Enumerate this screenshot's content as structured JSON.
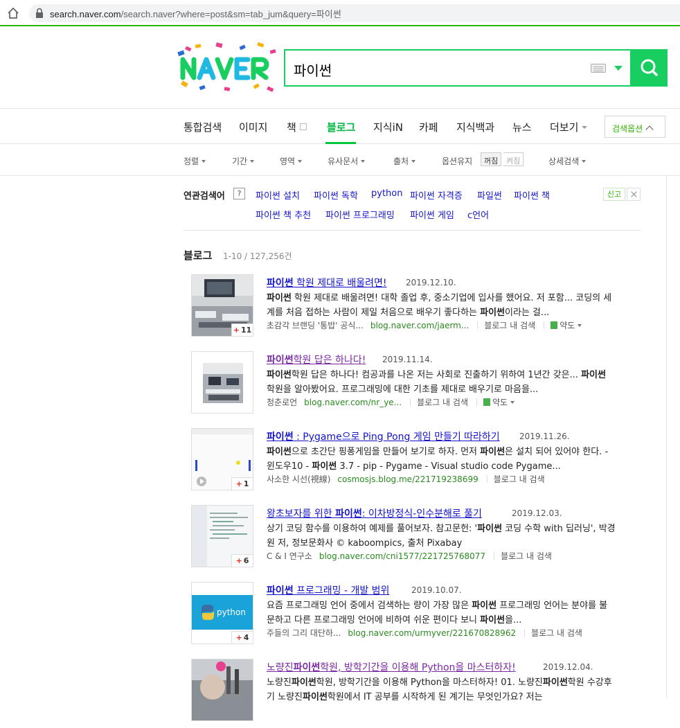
{
  "browser": {
    "url_host": "search.naver.com",
    "url_rest": "/search.naver?where=post&sm=tab_jum&query=파이썬"
  },
  "search": {
    "query": "파이썬"
  },
  "nav": {
    "tabs": [
      "통합검색",
      "이미지",
      "책",
      "블로그",
      "지식iN",
      "카페",
      "지식백과",
      "뉴스",
      "더보기"
    ],
    "active": "블로그",
    "options_button": "검색옵션"
  },
  "filters": {
    "items": [
      "정렬",
      "기간",
      "영역",
      "유사문서",
      "출처",
      "옵션유지",
      "상세검색"
    ],
    "toggle_on": "꺼짐",
    "toggle_off": "켜짐"
  },
  "related": {
    "label": "연관검색어",
    "help": "?",
    "row1": [
      "파이썬 설치",
      "파이썬 독학",
      "python",
      "파이썬 자격증",
      "파일썬",
      "파이썬 책"
    ],
    "row2": [
      "파이썬 책 추천",
      "파이썬 프로그래밍",
      "파이썬 게임",
      "c언어"
    ],
    "report": "신고"
  },
  "section": {
    "title": "블로그",
    "count": "1-10 / 127,256건"
  },
  "results": [
    {
      "title_bold": "파이썬",
      "title_rest": " 학원 제대로 배울려면!",
      "date": "2019.12.10.",
      "desc_l1_bold": "파이썬",
      "desc_l1": " 학원 제대로 배울려면! 대학 졸업 후, 중소기업에 입사를 했어요. 저 포함... 코딩의 세",
      "desc_l2": "계를 처음 접하는 사람이 제일 처음으로 배우기 좋다하는 ",
      "desc_l2_bold": "파이썬",
      "desc_l2_end": "이라는 걸...",
      "blog": "초감각 브랜딩 '통밥' 공식...",
      "url": "blog.naver.com/jaerm...",
      "in_blog": "블로그 내 검색",
      "map": "약도",
      "badge": "11"
    },
    {
      "title_bold": "파이썬",
      "title_rest": "학원 답은 하나다!",
      "date": "2019.11.14.",
      "desc_l1_bold": "파이썬",
      "desc_l1": "학원 답은 하나다! 컴공과를 나온 저는 사회로 진출하기 위하여 1년간 갖은... ",
      "desc_l1_bold2": "파이썬",
      "desc_l2": "학원을 알아봤어요. 프로그래밍에 대한 기초를 제대로 배우기로 마음을...",
      "blog": "청춘로언",
      "url": "blog.naver.com/nr_ye...",
      "in_blog": "블로그 내 검색",
      "map": "약도"
    },
    {
      "title_bold": "파이썬",
      "title_rest": " : Pygame으로 Ping Pong 게임 만들기 따라하기",
      "date": "2019.11.26.",
      "desc_l1_bold": "파이썬",
      "desc_l1": "으로 초간단 핑퐁게임을 만들어 보기로 하자. 먼저 ",
      "desc_l1_bold2": "파이썬",
      "desc_l1_end": "은 설치 되어 있어야 한다. -",
      "desc_l2": "윈도우10 - ",
      "desc_l2_bold": "파이썬",
      "desc_l2_end": " 3.7 - pip - Pygame - Visual studio code Pygame...",
      "blog": "사소한 시선(視線)",
      "url": "cosmosjs.blog.me/221719238699",
      "in_blog": "블로그 내 검색",
      "badge": "1"
    },
    {
      "title_pre": "왕초보자를 위한 ",
      "title_bold": "파이썬",
      "title_rest": ": 이차방정식-인수분해로 풀기",
      "date": "2019.12.03.",
      "desc_l1": "상기 코딩 함수를 이용하여 예제를 풀어보자. 참고문헌: '",
      "desc_l1_bold": "파이썬",
      "desc_l1_end": " 코딩 수학 with 딥러닝', 박경",
      "desc_l2": "원 저, 정보문화사 © kaboompics, 출처 Pixabay",
      "blog": "C & I 연구소",
      "url": "blog.naver.com/cni1577/221725768077",
      "in_blog": "블로그 내 검색",
      "badge": "6"
    },
    {
      "title_bold": "파이썬",
      "title_rest": " 프로그래밍 - 개발 범위",
      "date": "2019.10.07.",
      "desc_l1": "요즘 프로그래밍 언어 중에서 검색하는 량이 가장 많은 ",
      "desc_l1_bold": "파이썬",
      "desc_l1_end": " 프로그래밍 언어는 분야를 불",
      "desc_l2": "문하고 다른 프로그래밍 언어에 비하여 쉬운 편이다 보니 ",
      "desc_l2_bold": "파이썬",
      "desc_l2_end": "을...",
      "blog": "주들의 그리 대단하...",
      "url": "blog.naver.com/urmyver/221670828962",
      "in_blog": "블로그 내 검색",
      "badge": "4",
      "thumb_text": "python"
    },
    {
      "title_pre": "노량진",
      "title_bold": "파이썬",
      "title_rest": "학원, 방학기간을 이용해 Python을 마스터하자!",
      "date": "2019.12.04.",
      "desc_l1": "노량진",
      "desc_l1_bold": "파이썬",
      "desc_l1_end": "학원, 방학기간을 이용해 Python을 마스터하자! 01. 노량진",
      "desc_l1_bold2": "파이썬",
      "desc_l1_end2": "학원 수강후",
      "desc_l2": "기 노량진",
      "desc_l2_bold": "파이썬",
      "desc_l2_end": "학원에서 IT 공부를 시작하게 된 계기는 무엇인가요? 저는"
    }
  ],
  "colors": {
    "brand_green": "#19ce60",
    "link": "#1414cc",
    "visited": "#7a29a3",
    "url_green": "#2a8a1f"
  }
}
